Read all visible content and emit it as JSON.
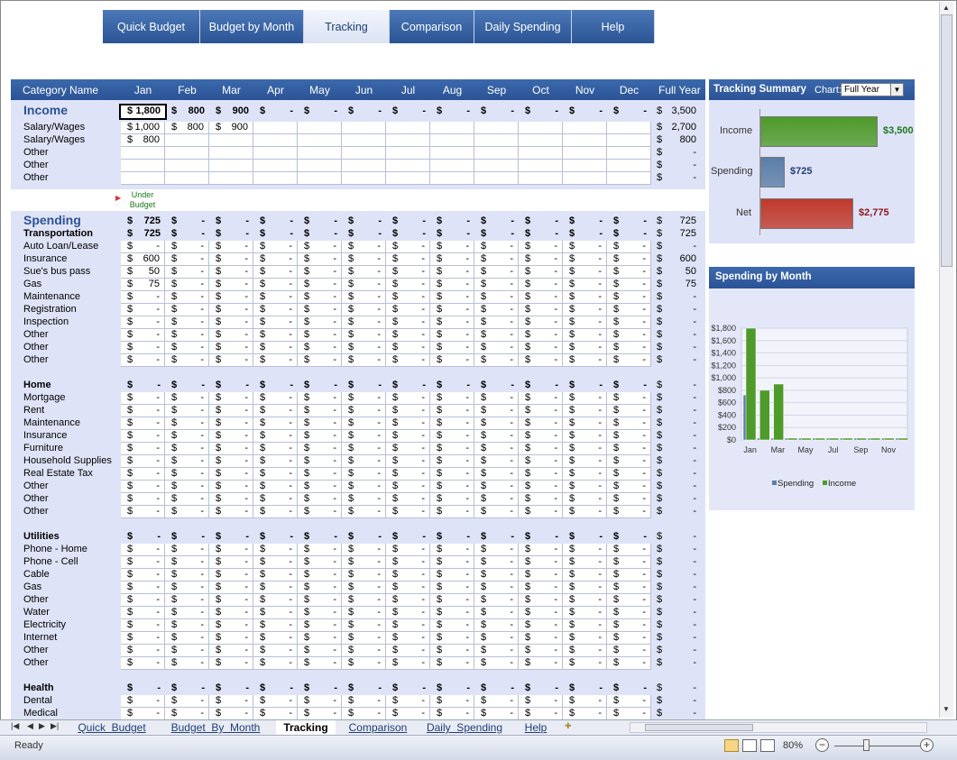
{
  "nav": {
    "tabs": [
      {
        "label": "Quick Budget",
        "active": false
      },
      {
        "label": "Budget by Month",
        "active": false
      },
      {
        "label": "Tracking",
        "active": true
      },
      {
        "label": "Comparison",
        "active": false
      },
      {
        "label": "Daily Spending",
        "active": false
      },
      {
        "label": "Help",
        "active": false
      }
    ]
  },
  "grid": {
    "category_header": "Category Name",
    "months": [
      "Jan",
      "Feb",
      "Mar",
      "Apr",
      "May",
      "Jun",
      "Jul",
      "Aug",
      "Sep",
      "Oct",
      "Nov",
      "Dec"
    ],
    "full_year_header": "Full Year",
    "under_budget_label": "Under Budget",
    "income": {
      "title": "Income",
      "total": [
        "$ 1,800",
        "$  800",
        "$  900",
        "$  -",
        "$  -",
        "$  -",
        "$  -",
        "$  -",
        "$  -",
        "$  -",
        "$  -",
        "$  -"
      ],
      "total_fy": "3,500",
      "items": [
        {
          "name": "Salary/Wages",
          "values": [
            "$ 1,000",
            "$  800",
            "$  900",
            "",
            "",
            "",
            "",
            "",
            "",
            "",
            "",
            ""
          ],
          "fy": "2,700"
        },
        {
          "name": "Salary/Wages",
          "values": [
            "$  800",
            "",
            "",
            "",
            "",
            "",
            "",
            "",
            "",
            "",
            "",
            ""
          ],
          "fy": "800"
        },
        {
          "name": "Other",
          "values": [
            "",
            "",
            "",
            "",
            "",
            "",
            "",
            "",
            "",
            "",
            "",
            ""
          ],
          "fy": "-"
        },
        {
          "name": "Other",
          "values": [
            "",
            "",
            "",
            "",
            "",
            "",
            "",
            "",
            "",
            "",
            "",
            ""
          ],
          "fy": "-"
        },
        {
          "name": "Other",
          "values": [
            "",
            "",
            "",
            "",
            "",
            "",
            "",
            "",
            "",
            "",
            "",
            ""
          ],
          "fy": "-"
        }
      ]
    },
    "spending": {
      "title": "Spending",
      "total_jan": "725",
      "total_fy": "725",
      "groups": [
        {
          "name": "Transportation",
          "jan": "725",
          "fy": "725",
          "items": [
            {
              "name": "Auto Loan/Lease",
              "jan": "-",
              "fy": "-"
            },
            {
              "name": "Insurance",
              "jan": "600",
              "fy": "600"
            },
            {
              "name": "Sue's bus pass",
              "jan": "50",
              "fy": "50"
            },
            {
              "name": "Gas",
              "jan": "75",
              "fy": "75"
            },
            {
              "name": "Maintenance",
              "jan": "-",
              "fy": "-"
            },
            {
              "name": "Registration",
              "jan": "-",
              "fy": "-"
            },
            {
              "name": "Inspection",
              "jan": "-",
              "fy": "-"
            },
            {
              "name": "Other",
              "jan": "-",
              "fy": "-"
            },
            {
              "name": "Other",
              "jan": "-",
              "fy": "-"
            },
            {
              "name": "Other",
              "jan": "-",
              "fy": "-"
            }
          ]
        },
        {
          "name": "Home",
          "jan": "-",
          "fy": "-",
          "items": [
            {
              "name": "Mortgage",
              "jan": "-",
              "fy": "-"
            },
            {
              "name": "Rent",
              "jan": "-",
              "fy": "-"
            },
            {
              "name": "Maintenance",
              "jan": "-",
              "fy": "-"
            },
            {
              "name": "Insurance",
              "jan": "-",
              "fy": "-"
            },
            {
              "name": "Furniture",
              "jan": "-",
              "fy": "-"
            },
            {
              "name": "Household Supplies",
              "jan": "-",
              "fy": "-"
            },
            {
              "name": "Real Estate Tax",
              "jan": "-",
              "fy": "-"
            },
            {
              "name": "Other",
              "jan": "-",
              "fy": "-"
            },
            {
              "name": "Other",
              "jan": "-",
              "fy": "-"
            },
            {
              "name": "Other",
              "jan": "-",
              "fy": "-"
            }
          ]
        },
        {
          "name": "Utilities",
          "jan": "-",
          "fy": "-",
          "items": [
            {
              "name": "Phone - Home",
              "jan": "-",
              "fy": "-"
            },
            {
              "name": "Phone - Cell",
              "jan": "-",
              "fy": "-"
            },
            {
              "name": "Cable",
              "jan": "-",
              "fy": "-"
            },
            {
              "name": "Gas",
              "jan": "-",
              "fy": "-"
            },
            {
              "name": "Other",
              "jan": "-",
              "fy": "-"
            },
            {
              "name": "Water",
              "jan": "-",
              "fy": "-"
            },
            {
              "name": "Electricity",
              "jan": "-",
              "fy": "-"
            },
            {
              "name": "Internet",
              "jan": "-",
              "fy": "-"
            },
            {
              "name": "Other",
              "jan": "-",
              "fy": "-"
            },
            {
              "name": "Other",
              "jan": "-",
              "fy": "-"
            }
          ]
        },
        {
          "name": "Health",
          "jan": "-",
          "fy": "-",
          "items": [
            {
              "name": "Dental",
              "jan": "-",
              "fy": "-"
            },
            {
              "name": "Medical",
              "jan": "-",
              "fy": "-"
            }
          ]
        }
      ]
    }
  },
  "tracking_summary": {
    "title": "Tracking Summary",
    "chart_label": "Chart:",
    "chart_select": "Full Year",
    "rows": [
      {
        "label": "Income",
        "value": "$3,500",
        "color": "#4e9a2a",
        "label_color": "#1e7a1e"
      },
      {
        "label": "Spending",
        "value": "$725",
        "color": "#5b7ea8",
        "label_color": "#1f3d78"
      },
      {
        "label": "Net",
        "value": "$2,775",
        "color": "#c0392b",
        "label_color": "#8b1a1a"
      }
    ]
  },
  "chart_data": {
    "type": "bar",
    "title": "Spending by Month",
    "categories": [
      "Jan",
      "Feb",
      "Mar",
      "Apr",
      "May",
      "Jun",
      "Jul",
      "Aug",
      "Sep",
      "Oct",
      "Nov",
      "Dec"
    ],
    "x_tick_labels": [
      "Jan",
      "Mar",
      "May",
      "Jul",
      "Sep",
      "Nov"
    ],
    "y_tick_labels": [
      "$0",
      "$200",
      "$400",
      "$600",
      "$800",
      "$1,000",
      "$1,200",
      "$1,400",
      "$1,600",
      "$1,800"
    ],
    "ylim": [
      0,
      1800
    ],
    "series": [
      {
        "name": "Spending",
        "color": "#5b7ea8",
        "values": [
          725,
          0,
          0,
          0,
          0,
          0,
          0,
          0,
          0,
          0,
          0,
          0
        ]
      },
      {
        "name": "Income",
        "color": "#4e9a2a",
        "values": [
          1800,
          800,
          900,
          0,
          0,
          0,
          0,
          0,
          0,
          0,
          0,
          0
        ]
      }
    ],
    "legend": "bottom"
  },
  "sheet_tabs": [
    {
      "label": "Quick  Budget",
      "active": false
    },
    {
      "label": "Budget  By  Month",
      "active": false
    },
    {
      "label": "Tracking",
      "active": true
    },
    {
      "label": "Comparison",
      "active": false
    },
    {
      "label": "Daily  Spending",
      "active": false
    },
    {
      "label": "Help",
      "active": false
    }
  ],
  "status": {
    "ready": "Ready",
    "zoom": "80%"
  }
}
